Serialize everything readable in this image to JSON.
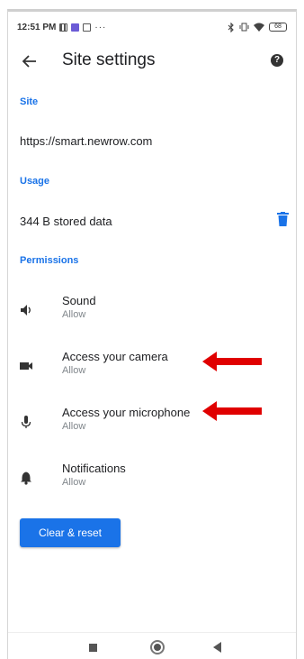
{
  "status_bar": {
    "time": "12:51 PM",
    "dots": "···",
    "right_icons": [
      "bluetooth-icon",
      "vibrate-icon",
      "wifi-icon"
    ],
    "battery": "68"
  },
  "app_bar": {
    "title": "Site settings",
    "back_icon": "arrow-left-icon",
    "help_icon": "help-icon",
    "help_glyph": "?"
  },
  "site": {
    "header": "Site",
    "url": "https://smart.newrow.com"
  },
  "usage": {
    "header": "Usage",
    "stored_data": "344 B stored data",
    "delete_icon": "trash-icon"
  },
  "permissions": {
    "header": "Permissions",
    "items": [
      {
        "title": "Sound",
        "status": "Allow",
        "icon": "speaker-icon"
      },
      {
        "title": "Access your camera",
        "status": "Allow",
        "icon": "camera-icon"
      },
      {
        "title": "Access your microphone",
        "status": "Allow",
        "icon": "microphone-icon"
      },
      {
        "title": "Notifications",
        "status": "Allow",
        "icon": "bell-icon"
      }
    ]
  },
  "actions": {
    "clear_reset": "Clear & reset"
  },
  "annotations": {
    "arrow_color": "#e00000"
  },
  "colors": {
    "accent": "#1a73e8",
    "text": "#202124",
    "secondary_text": "#80868b"
  }
}
